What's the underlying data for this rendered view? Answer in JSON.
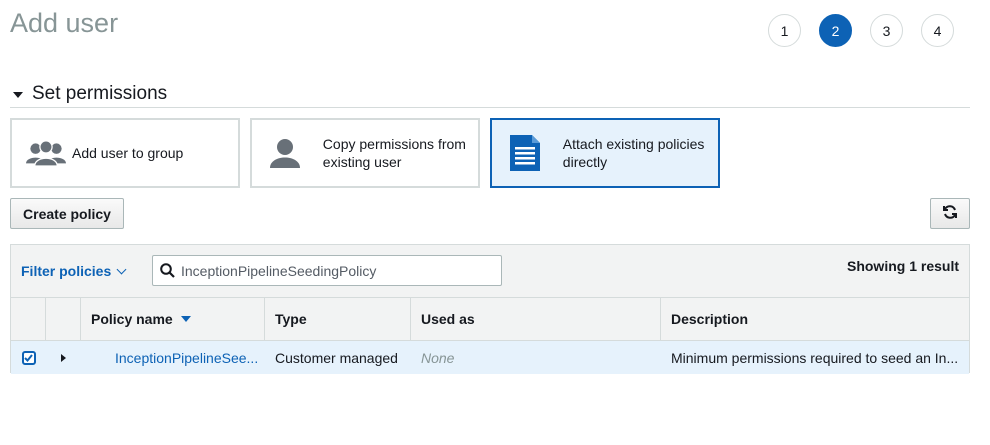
{
  "page": {
    "title": "Add user"
  },
  "steps": [
    "1",
    "2",
    "3",
    "4"
  ],
  "active_step": "2",
  "section": {
    "title": "Set permissions"
  },
  "options": [
    {
      "label": "Add user to group",
      "icon": "group-icon"
    },
    {
      "label": "Copy permissions from existing user",
      "icon": "user-icon"
    },
    {
      "label": "Attach existing policies directly",
      "icon": "document-icon",
      "selected": true
    }
  ],
  "toolbar": {
    "create_policy_label": "Create policy",
    "refresh_icon": "refresh-icon"
  },
  "filter": {
    "label": "Filter policies",
    "search_value": "InceptionPipelineSeedingPolicy",
    "result_count": "Showing 1 result"
  },
  "table": {
    "columns": [
      "Policy name",
      "Type",
      "Used as",
      "Description"
    ],
    "rows": [
      {
        "checked": true,
        "policy_name": "InceptionPipelineSee...",
        "type": "Customer managed",
        "used_as": "None",
        "description": "Minimum permissions required to seed an In..."
      }
    ]
  },
  "colors": {
    "accent": "#0d62b5",
    "selected_bg": "#e6f2fc",
    "header_bg": "#f2f3f3"
  }
}
